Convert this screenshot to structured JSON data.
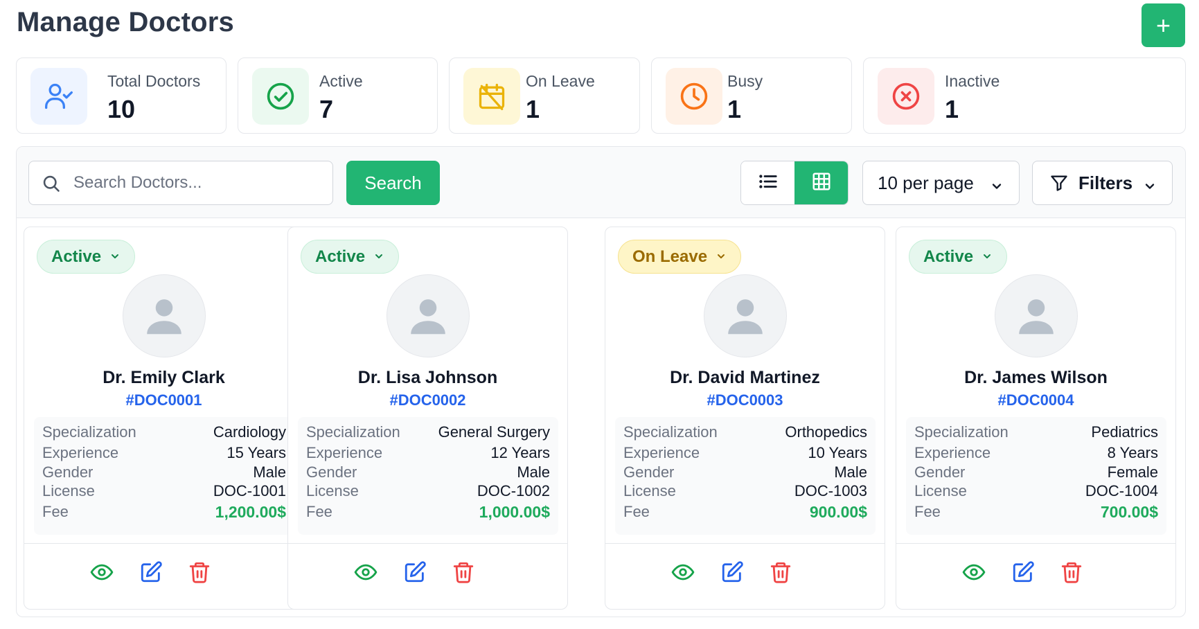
{
  "header": {
    "title": "Manage Doctors",
    "add_label": "+"
  },
  "stats": [
    {
      "label": "Total Doctors",
      "value": "10",
      "icon": "user-check-icon",
      "color": "#3b82f6",
      "bg": "#eef4ff"
    },
    {
      "label": "Active",
      "value": "7",
      "icon": "check-circle-icon",
      "color": "#16a34a",
      "bg": "#ebf9f0"
    },
    {
      "label": "On Leave",
      "value": "1",
      "icon": "calendar-off-icon",
      "color": "#eab308",
      "bg": "#fef7d6"
    },
    {
      "label": "Busy",
      "value": "1",
      "icon": "clock-icon",
      "color": "#f97316",
      "bg": "#fff1e6"
    },
    {
      "label": "Inactive",
      "value": "1",
      "icon": "x-circle-icon",
      "color": "#ef4444",
      "bg": "#fdecec"
    }
  ],
  "toolbar": {
    "search_placeholder": "Search Doctors...",
    "search_label": "Search",
    "per_page_label": "10 per page",
    "filters_label": "Filters"
  },
  "detail_labels": {
    "specialization": "Specialization",
    "experience": "Experience",
    "gender": "Gender",
    "license": "License",
    "fee": "Fee"
  },
  "doctors": [
    {
      "status": "Active",
      "name": "Dr. Emily Clark",
      "id": "#DOC0001",
      "specialization": "Cardiology",
      "experience": "15 Years",
      "gender": "Male",
      "license": "DOC-1001",
      "fee": "1,200.00$"
    },
    {
      "status": "Active",
      "name": "Dr. Lisa Johnson",
      "id": "#DOC0002",
      "specialization": "General Surgery",
      "experience": "12 Years",
      "gender": "Male",
      "license": "DOC-1002",
      "fee": "1,000.00$"
    },
    {
      "status": "On Leave",
      "name": "Dr. David Martinez",
      "id": "#DOC0003",
      "specialization": "Orthopedics",
      "experience": "10 Years",
      "gender": "Male",
      "license": "DOC-1003",
      "fee": "900.00$"
    },
    {
      "status": "Active",
      "name": "Dr. James Wilson",
      "id": "#DOC0004",
      "specialization": "Pediatrics",
      "experience": "8 Years",
      "gender": "Female",
      "license": "DOC-1004",
      "fee": "700.00$"
    }
  ],
  "colors": {
    "accent": "#22b573",
    "link": "#2563eb",
    "fee": "#1eaa5c",
    "danger": "#ef4444"
  }
}
